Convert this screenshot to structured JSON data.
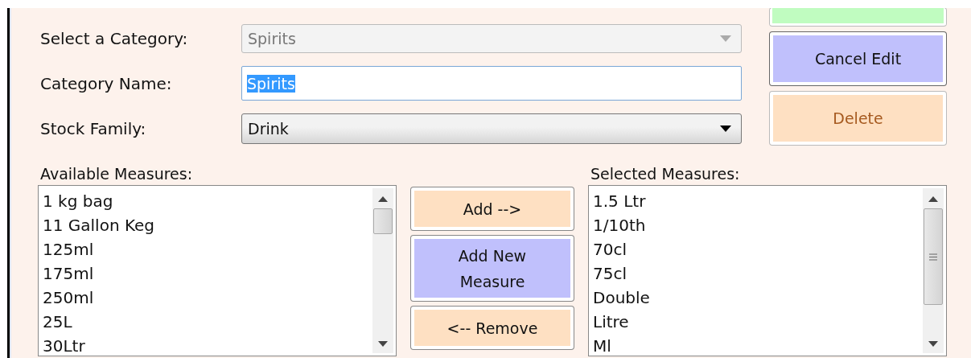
{
  "form": {
    "fields": [
      {
        "label": "Select a Category:",
        "kind": "dropdown",
        "value": "Spirits",
        "disabled": true
      },
      {
        "label": "Category Name:",
        "kind": "text",
        "value": "Spirits",
        "highlighted": true
      },
      {
        "label": "Stock Family:",
        "kind": "dropdown",
        "value": "Drink",
        "disabled": false
      }
    ]
  },
  "actions": [
    {
      "kind": "confirm"
    },
    {
      "label": "Cancel Edit",
      "kind": "cancel"
    },
    {
      "label": "Delete",
      "kind": "delete"
    }
  ],
  "available_measures": {
    "label": "Available Measures:",
    "items": [
      "1 kg bag",
      "11 Gallon Keg",
      "125ml",
      "175ml",
      "250ml",
      "25L",
      "30Ltr"
    ]
  },
  "transfer_buttons": [
    {
      "label": "Add -->",
      "kind": "transfer"
    },
    {
      "label": "Add New Measure",
      "kind": "new"
    },
    {
      "label": "<-- Remove",
      "kind": "transfer"
    }
  ],
  "selected_measures": {
    "label": "Selected Measures:",
    "items": [
      "1.5 Ltr",
      "1/10th",
      "70cl",
      "75cl",
      "Double",
      "Litre",
      "Ml"
    ]
  }
}
